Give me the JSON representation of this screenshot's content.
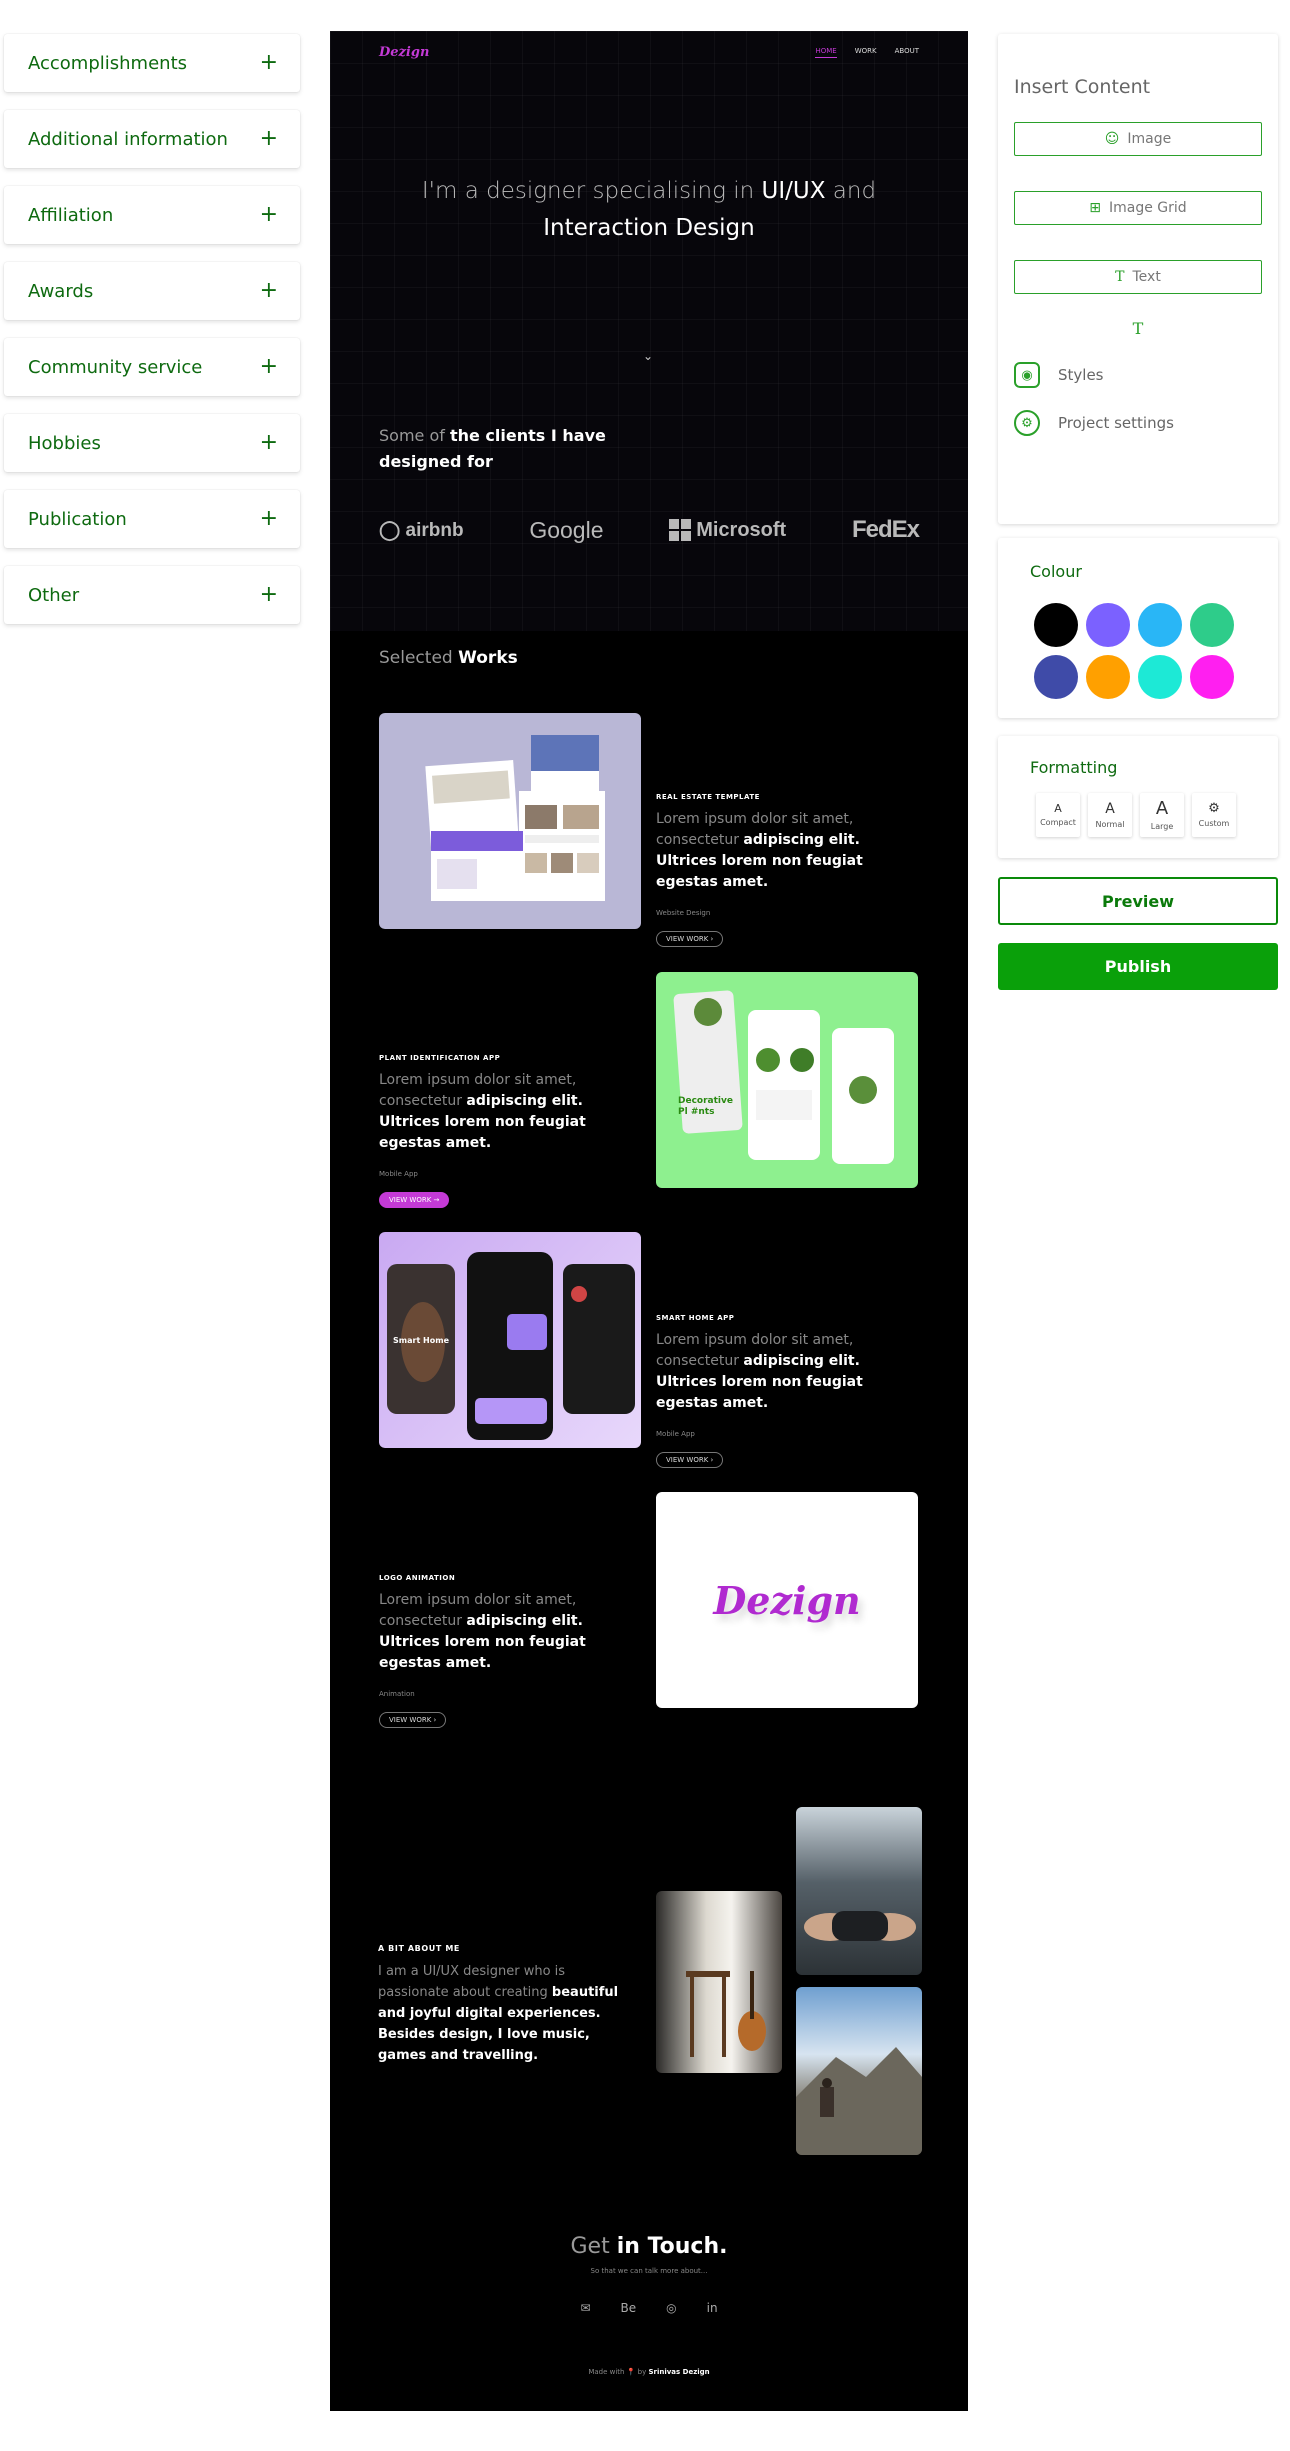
{
  "sidebar": {
    "sections": [
      {
        "label": "Accomplishments"
      },
      {
        "label": "Additional information"
      },
      {
        "label": "Affiliation"
      },
      {
        "label": "Awards"
      },
      {
        "label": "Community service"
      },
      {
        "label": "Hobbies"
      },
      {
        "label": "Publication"
      },
      {
        "label": "Other"
      }
    ],
    "expand_glyph": "+"
  },
  "portfolio": {
    "logo": "Dezign",
    "nav": [
      "HOME",
      "WORK",
      "ABOUT"
    ],
    "hero": {
      "prefix": "I'm a designer specialising in ",
      "bold1": "UI/UX",
      "mid": " and",
      "bold2": "Interaction Design"
    },
    "scroll_icon": "chevron-down",
    "clients": {
      "prefix": "Some of ",
      "bold": "the clients I have designed for"
    },
    "client_logos": [
      "airbnb",
      "Google",
      "Microsoft",
      "FedEx"
    ],
    "selected": {
      "prefix": "Selected ",
      "bold": "Works"
    },
    "works": [
      {
        "caption": "REAL ESTATE TEMPLATE",
        "desc_light": "Lorem ipsum dolor sit amet, consectetur ",
        "desc_bold": "adipiscing elit. Ultrices lorem non feugiat egestas amet.",
        "type": "Website Design",
        "button": "VIEW WORK"
      },
      {
        "caption": "PLANT IDENTIFICATION APP",
        "desc_light": "Lorem ipsum dolor sit amet, consectetur ",
        "desc_bold": "adipiscing elit. Ultrices lorem non feugiat egestas amet.",
        "type": "Mobile App",
        "button": "VIEW WORK"
      },
      {
        "caption": "SMART HOME APP",
        "desc_light": "Lorem ipsum dolor sit amet, consectetur ",
        "desc_bold": "adipiscing elit. Ultrices lorem non feugiat egestas amet.",
        "type": "Mobile App",
        "button": "VIEW WORK"
      },
      {
        "caption": "LOGO ANIMATION",
        "desc_light": "Lorem ipsum dolor sit amet, consectetur ",
        "desc_bold": "adipiscing elit. Ultrices lorem non feugiat egestas amet.",
        "type": "Animation",
        "button": "VIEW WORK"
      }
    ],
    "plant_card": {
      "line1": "Decorative",
      "line2": "Pl #nts"
    },
    "smart_card": {
      "title": "Smart Home"
    },
    "about": {
      "caption": "A BIT ABOUT ME",
      "desc_light": "I am a UI/UX designer who is passionate about creating ",
      "desc_bold": "beautiful and joyful digital experiences. Besides design, I love music, games and travelling."
    },
    "touch": {
      "prefix": "Get ",
      "bold": "in Touch.",
      "sub": "So that we can talk more about..."
    },
    "social": [
      "✉",
      "Be",
      "◎",
      "in"
    ],
    "footer": {
      "prefix": "Made with ",
      "heart": "📍",
      "by": " by ",
      "name": "Srinivas Dezign"
    }
  },
  "insert_panel": {
    "title": "Insert Content",
    "buttons": [
      {
        "label": "Image",
        "icon": "image-icon"
      },
      {
        "label": "Image Grid",
        "icon": "grid-icon"
      },
      {
        "label": "Text",
        "icon": "text-icon"
      }
    ],
    "text_tool_glyph": "T",
    "links": [
      {
        "label": "Styles",
        "icon": "styles-icon"
      },
      {
        "label": "Project settings",
        "icon": "gear-icon"
      }
    ]
  },
  "colour_panel": {
    "title": "Colour",
    "swatches": [
      "#000000",
      "#7b61ff",
      "#29b6f6",
      "#2ecc8a",
      "#3f4ba8",
      "#ffa000",
      "#1de9d6",
      "#ff1ff0"
    ]
  },
  "formatting_panel": {
    "title": "Formatting",
    "options": [
      {
        "glyph": "A",
        "label": "Compact"
      },
      {
        "glyph": "A",
        "label": "Normal"
      },
      {
        "glyph": "A",
        "label": "Large"
      },
      {
        "glyph": "⚙",
        "label": "Custom"
      }
    ]
  },
  "actions": {
    "preview": "Preview",
    "publish": "Publish"
  }
}
